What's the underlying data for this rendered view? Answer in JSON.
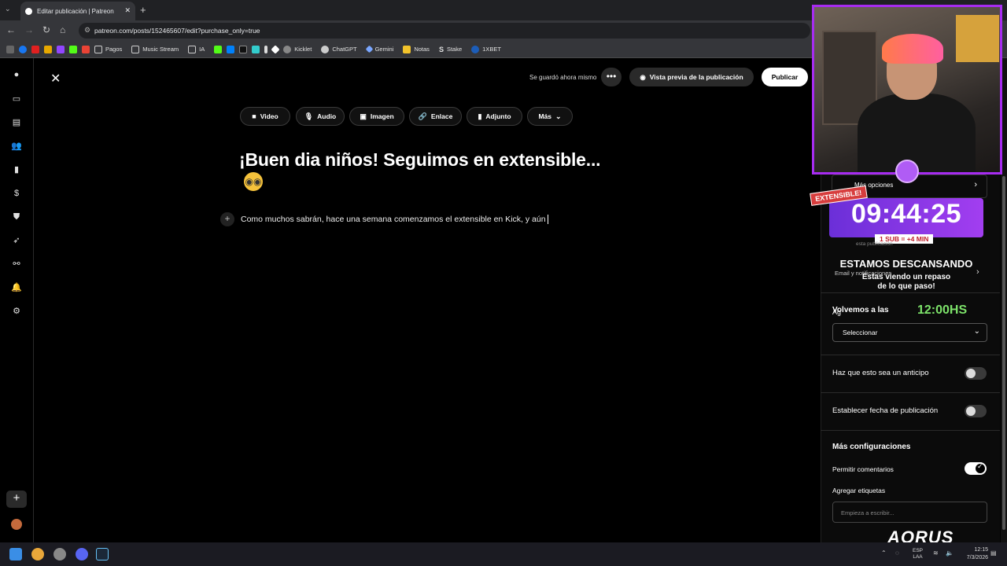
{
  "browser": {
    "tab_title": "Editar publicación | Patreon",
    "url": "patreon.com/posts/152465607/edit?purchase_only=true",
    "bookmarks": [
      "Pagos",
      "Music Stream",
      "IA",
      "Kicklet",
      "ChatGPT",
      "Gemini",
      "Notas",
      "Stake",
      "1XBET"
    ]
  },
  "header": {
    "save_status": "Se guardó ahora mismo",
    "more_label": "•••",
    "preview_label": "Vista previa de la publicación",
    "publish_label": "Publicar"
  },
  "toolbar": {
    "video": "Video",
    "audio": "Audio",
    "image": "Imagen",
    "link": "Enlace",
    "attachment": "Adjunto",
    "more": "Más"
  },
  "post": {
    "title": "¡Buen dia niños! Seguimos en extensible...",
    "body": "Como muchos sabrán, hace una semana comenzamos el extensible en Kick, y aún"
  },
  "panel": {
    "more_options": "Más opciones",
    "email_notifications": "Email y notificaciones",
    "add_to_collection_partial": "Ag",
    "select_placeholder": "Seleccionar",
    "early_access_label": "Haz que esto sea un anticipo",
    "schedule_label": "Establecer fecha de publicación",
    "more_settings_title": "Más configuraciones",
    "allow_comments_label": "Permitir comentarios",
    "add_tags_label": "Agregar etiquetas",
    "tags_placeholder": "Empieza a escribir..."
  },
  "toggles": {
    "early_access": false,
    "schedule": false,
    "allow_comments": true
  },
  "overlay": {
    "badge": "EXTENSIBLE!",
    "timer": "09:44:25",
    "sub_rule": "1 SUB = +4 MIN",
    "under_text": "esta publicación",
    "resting": "ESTAMOS DESCANSANDO",
    "recap_line1": "Estas viendo un repaso",
    "recap_line2": "de lo que paso!",
    "return_label": "Volvemos a las",
    "return_time": "12:00HS",
    "brand": "AORUS"
  },
  "taskbar": {
    "lang_line1": "ESP",
    "lang_line2": "LAA",
    "time": "12:15",
    "date": "7/3/2026"
  },
  "colors": {
    "accent_purple": "#a72cf1",
    "return_time_green": "#7de36a",
    "badge_red": "#d73d3d"
  }
}
